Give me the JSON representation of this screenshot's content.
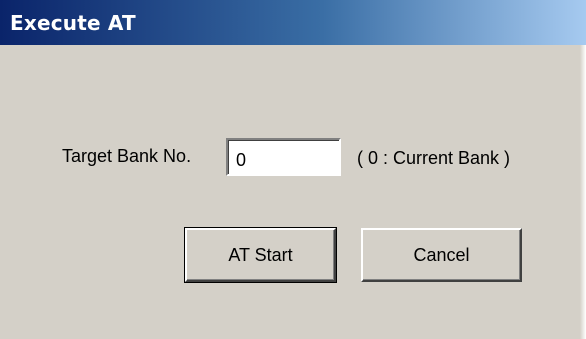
{
  "window": {
    "title": "Execute AT"
  },
  "form": {
    "target_bank_label": "Target Bank No.",
    "target_bank_value": "0",
    "hint": "( 0 : Current Bank )"
  },
  "buttons": {
    "start_label": "AT Start",
    "cancel_label": "Cancel"
  },
  "colors": {
    "title_gradient_start": "#0a246a",
    "title_gradient_end": "#a6caf0",
    "dialog_background": "#d4d0c8"
  }
}
